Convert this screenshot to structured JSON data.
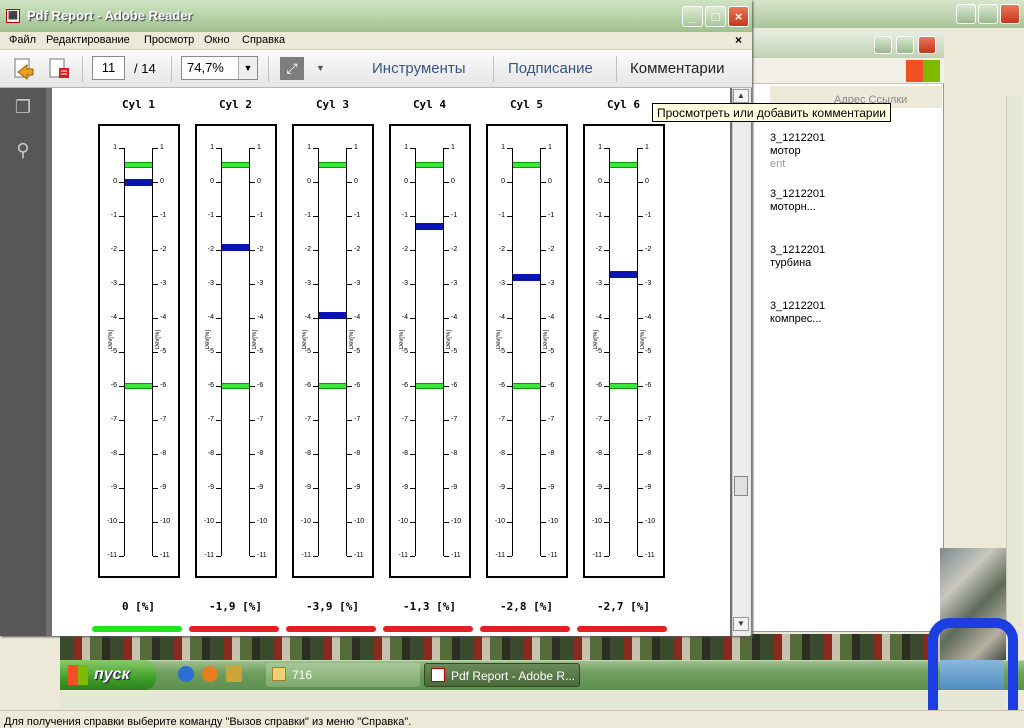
{
  "window": {
    "title": "Pdf Report - Adobe Reader"
  },
  "menu": [
    "Файл",
    "Редактирование",
    "Просмотр",
    "Окно",
    "Справка"
  ],
  "toolbar": {
    "page_current": "11",
    "page_total": "/ 14",
    "zoom": "74,7%",
    "tools": "Инструменты",
    "sign": "Подписание",
    "comments": "Комментарии"
  },
  "tooltip": "Просмотреть или добавить комментарии",
  "axis_label": "Dev[%]",
  "chart_data": {
    "type": "bar",
    "categories": [
      "Cyl 1",
      "Cyl 2",
      "Cyl 3",
      "Cyl 4",
      "Cyl 5",
      "Cyl 6"
    ],
    "values": [
      0,
      -1.9,
      -3.9,
      -1.3,
      -2.8,
      -2.7
    ],
    "value_labels": [
      "0 [%]",
      "-1,9 [%]",
      "-3,9 [%]",
      "-1,3 [%]",
      "-2,8 [%]",
      "-2,7 [%]"
    ],
    "ylim": [
      -11,
      1
    ],
    "ticks": [
      1,
      0,
      -1,
      -2,
      -3,
      -4,
      -5,
      -6,
      -7,
      -8,
      -9,
      -10,
      -11
    ],
    "limits": [
      0.5,
      -6
    ],
    "status_colors": [
      "#1ee61e",
      "#e62020",
      "#e62020",
      "#e62020",
      "#e62020",
      "#e62020"
    ],
    "colors": {
      "limit": "#39e63a",
      "value": "#0a14b0"
    }
  },
  "background_window": {
    "header_partial": "Адрес   Ссылки",
    "items": [
      [
        "3_1212201",
        "мотор",
        "ent"
      ],
      [
        "3_1212201",
        "моторн..."
      ],
      [
        "3_1212201",
        "турбина"
      ],
      [
        "3_1212201",
        "компрес..."
      ]
    ]
  },
  "taskbar": {
    "start": "пуск",
    "tasks": [
      "716",
      "Pdf Report - Adobe R..."
    ]
  },
  "statusbar": "Для получения справки выберите команду \"Вызов справки\" из меню \"Справка\"."
}
